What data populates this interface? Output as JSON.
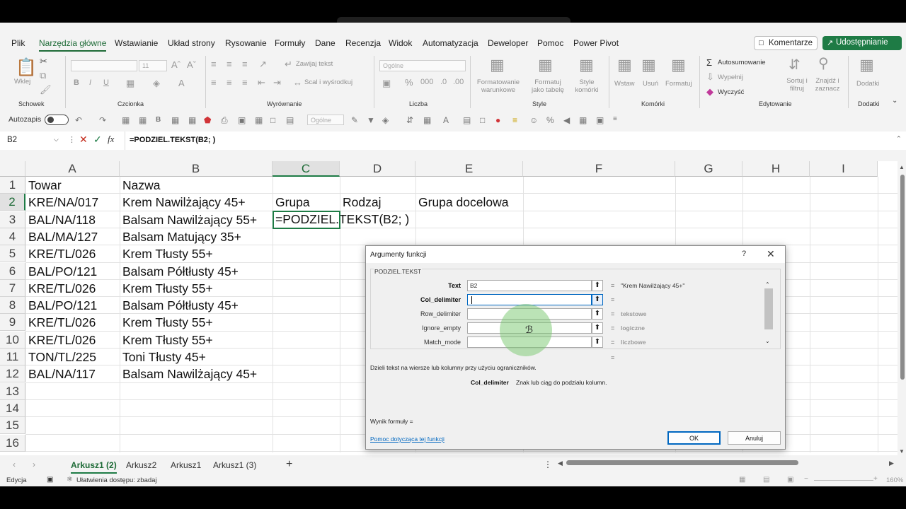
{
  "menu": {
    "tabs": [
      "Plik",
      "Narzędzia główne",
      "Wstawianie",
      "Układ strony",
      "Rysowanie",
      "Formuły",
      "Dane",
      "Recenzja",
      "Widok",
      "Automatyzacja",
      "Deweloper",
      "Pomoc",
      "Power Pivot"
    ],
    "active_tab": "Narzędzia główne",
    "comments_label": "Komentarze",
    "share_label": "Udostępnianie"
  },
  "ribbon": {
    "groups": {
      "clipboard": "Schowek",
      "font": "Czcionka",
      "alignment": "Wyrównanie",
      "number": "Liczba",
      "styles": "Style",
      "cells": "Komórki",
      "editing": "Edytowanie",
      "addins": "Dodatki"
    },
    "paste_label": "Wklej",
    "font_size": "11",
    "wrap_text": "Zawijaj tekst",
    "merge_center": "Scal i wyśrodkuj",
    "number_format": "Ogólne",
    "conditional_formatting": "Formatowanie warunkowe",
    "format_as_table": "Formatuj jako tabelę",
    "cell_styles": "Style komórki",
    "insert": "Wstaw",
    "delete": "Usuń",
    "format": "Formatuj",
    "autosum": "Autosumowanie",
    "fill": "Wypełnij",
    "clear": "Wyczyść",
    "sort_filter": "Sortuj i filtruj",
    "find_select": "Znajdź i zaznacz",
    "addins_btn": "Dodatki"
  },
  "qat": {
    "autosave_label": "Autozapis",
    "format_combo": "Ogólne"
  },
  "formula_bar": {
    "name_box": "B2",
    "fx_label": "fx",
    "formula": "=PODZIEL.TEKST(B2; )"
  },
  "sheet": {
    "columns": [
      "A",
      "B",
      "C",
      "D",
      "E",
      "F",
      "G",
      "H",
      "I"
    ],
    "selected_column": "C",
    "rows": [
      "1",
      "2",
      "3",
      "4",
      "5",
      "6",
      "7",
      "8",
      "9",
      "10",
      "11",
      "12",
      "13",
      "14",
      "15",
      "16"
    ],
    "cells": {
      "a": [
        "Towar",
        "KRE/NA/017",
        "BAL/NA/118",
        "BAL/MA/127",
        "KRE/TL/026",
        "BAL/PO/121",
        "KRE/TL/026",
        "BAL/PO/121",
        "KRE/TL/026",
        "KRE/TL/026",
        "TON/TL/225",
        "BAL/NA/117"
      ],
      "b": [
        "Nazwa",
        "Krem Nawilżający 45+",
        "Balsam Nawilżający 55+",
        "Balsam Matujący 35+",
        "Krem Tłusty 55+",
        "Balsam Półtłusty 45+",
        "Krem Tłusty 55+",
        "Balsam Półtłusty 45+",
        "Krem Tłusty 55+",
        "Krem Tłusty 55+",
        "Toni Tłusty 45+",
        "Balsam Nawilżający 45+"
      ],
      "c1": "Grupa",
      "d1": "Rodzaj",
      "e1": "Grupa docelowa",
      "c2_editing": "=PODZIEL.TEKST(B2; )"
    }
  },
  "sheet_tabs": [
    "Arkusz1 (2)",
    "Arkusz2",
    "Arkusz1",
    "Arkusz1 (3)"
  ],
  "active_sheet_tab": "Arkusz1 (2)",
  "status": {
    "mode": "Edycja",
    "accessibility": "Ułatwienia dostępu: zbadaj",
    "zoom": "160%"
  },
  "dialog": {
    "title": "Argumenty funkcji",
    "help_glyph": "?",
    "function_name": "PODZIEL.TEKST",
    "args": [
      {
        "label": "Text",
        "value": "B2",
        "result": "\"Krem Nawilżający 45+\"",
        "bold": true
      },
      {
        "label": "Col_delimiter",
        "value": "",
        "result": "",
        "bold": true
      },
      {
        "label": "Row_delimiter",
        "value": "",
        "result": "tekstowe",
        "bold": false
      },
      {
        "label": "Ignore_empty",
        "value": "",
        "result": "logiczne",
        "bold": false
      },
      {
        "label": "Match_mode",
        "value": "",
        "result": "liczbowe",
        "bold": false
      }
    ],
    "description": "Dzieli tekst na wiersze lub kolumny przy użyciu ograniczników.",
    "current_arg_name": "Col_delimiter",
    "current_arg_desc": "Znak lub ciąg do podziału kolumn.",
    "result_label": "Wynik formuły =",
    "help_link": "Pomoc dotycząca tej funkcji",
    "ok_label": "OK",
    "cancel_label": "Anuluj"
  }
}
